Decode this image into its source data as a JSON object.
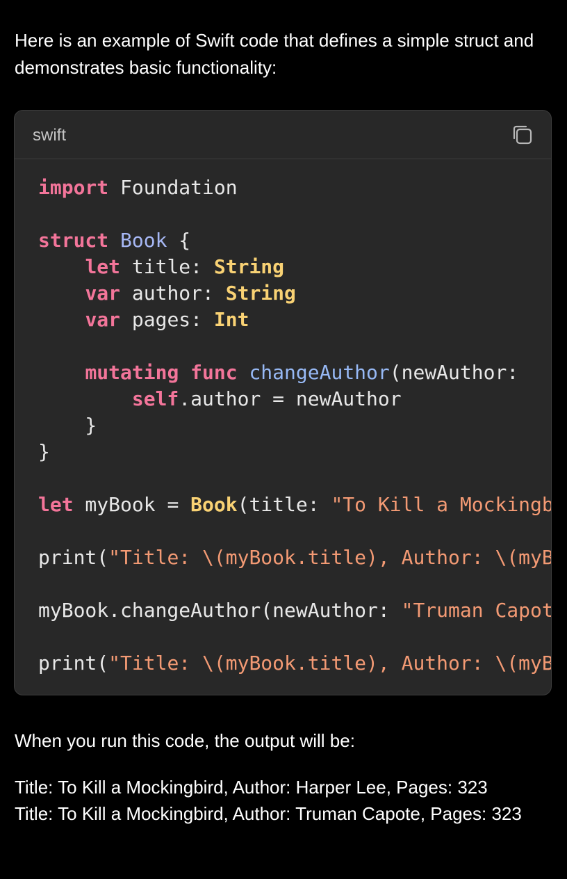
{
  "intro_text": "Here is an example of Swift code that defines a simple struct and demonstrates basic functionality:",
  "code_block": {
    "language": "swift",
    "copy_icon": "copy-icon",
    "lines": {
      "l1": {
        "a": "import",
        "b": " Foundation"
      },
      "l3": {
        "a": "struct",
        "b": " ",
        "c": "Book",
        "d": " {"
      },
      "l4": {
        "a": "    ",
        "b": "let",
        "c": " title: ",
        "d": "String"
      },
      "l5": {
        "a": "    ",
        "b": "var",
        "c": " author: ",
        "d": "String"
      },
      "l6": {
        "a": "    ",
        "b": "var",
        "c": " pages: ",
        "d": "Int"
      },
      "l8": {
        "a": "    ",
        "b": "mutating",
        "c": " ",
        "d": "func",
        "e": " ",
        "f": "changeAuthor",
        "g": "(newAuthor: "
      },
      "l9": {
        "a": "        ",
        "b": "self",
        "c": ".author = newAuthor"
      },
      "l10": {
        "a": "    }"
      },
      "l11": {
        "a": "}"
      },
      "l13": {
        "a": "let",
        "b": " myBook = ",
        "c": "Book",
        "d": "(title: ",
        "e": "\"To Kill a Mockingbird\""
      },
      "l15": {
        "a": "print(",
        "b": "\"Title: \\(myBook.title), Author: \\(myBook.author)\""
      },
      "l17": {
        "a": "myBook.changeAuthor(newAuthor: ",
        "b": "\"Truman Capote\""
      },
      "l19": {
        "a": "print(",
        "b": "\"Title: \\(myBook.title), Author: \\(myBook.author)\""
      }
    }
  },
  "outro_text": "When you run this code, the output will be:",
  "output_lines": [
    "Title: To Kill a Mockingbird, Author: Harper Lee, Pages: 323",
    "Title: To Kill a Mockingbird, Author: Truman Capote, Pages: 323"
  ]
}
